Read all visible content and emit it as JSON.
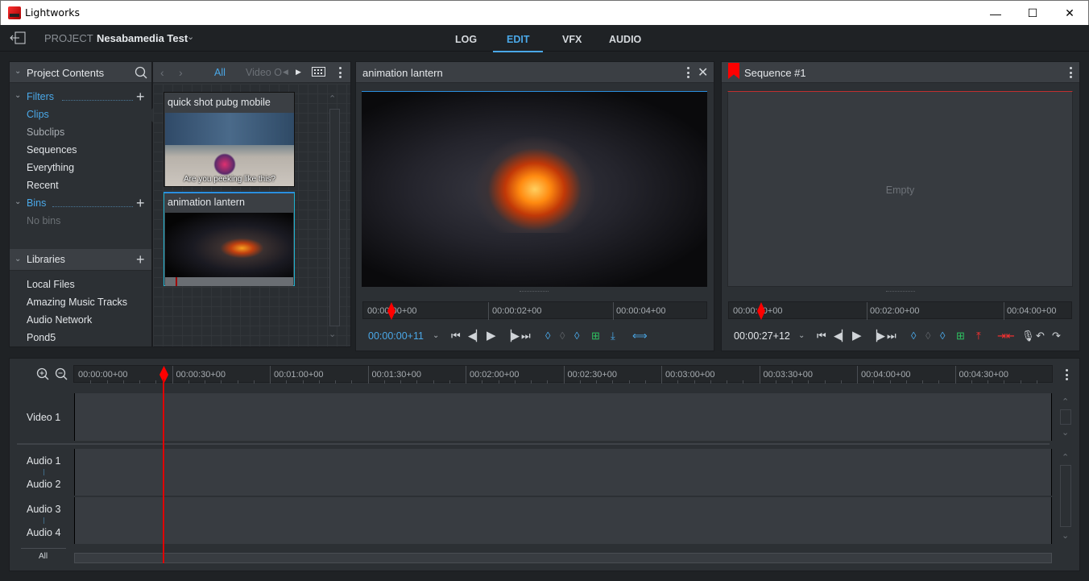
{
  "window": {
    "title": "Lightworks",
    "controls": {
      "minimize": "—",
      "maximize": "☐",
      "close": "✕"
    }
  },
  "topbar": {
    "project_label": "PROJECT",
    "project_name": "Nesabamedia Test",
    "project_chevron": "⌄",
    "tabs": [
      {
        "label": "LOG",
        "active": false
      },
      {
        "label": "EDIT",
        "active": true
      },
      {
        "label": "VFX",
        "active": false
      },
      {
        "label": "AUDIO",
        "active": false
      }
    ],
    "accent": "#4aa8e8"
  },
  "project_contents": {
    "title": "Project Contents",
    "filters": {
      "label": "Filters",
      "items": [
        {
          "label": "Clips",
          "state": "selected"
        },
        {
          "label": "Subclips",
          "state": "dim"
        },
        {
          "label": "Sequences",
          "state": "normal"
        },
        {
          "label": "Everything",
          "state": "normal"
        },
        {
          "label": "Recent",
          "state": "normal"
        }
      ]
    },
    "bins": {
      "label": "Bins",
      "empty_text": "No bins"
    },
    "libraries": {
      "label": "Libraries",
      "items": [
        "Local Files",
        "Amazing Music Tracks",
        "Audio Network",
        "Pond5"
      ]
    }
  },
  "bin_browser": {
    "filter_all": "All",
    "filter_video": "Video O",
    "clips": [
      {
        "title": "quick shot pubg mobile",
        "caption": "Are you peeking like this?",
        "selected": false
      },
      {
        "title": "animation lantern",
        "selected": true
      }
    ]
  },
  "source_viewer": {
    "title": "animation lantern",
    "ruler": [
      "00:00:00+00",
      "00:00:02+00",
      "00:00:04+00"
    ],
    "timecode": "00:00:00+11",
    "playhead_fraction": 0.07
  },
  "record_viewer": {
    "title": "Sequence #1",
    "empty_text": "Empty",
    "ruler": [
      "00:00:00+00",
      "00:02:00+00",
      "00:04:00+00"
    ],
    "timecode": "00:00:27+12",
    "playhead_fraction": 0.09
  },
  "timeline": {
    "ruler": [
      "00:00:00+00",
      "00:00:30+00",
      "00:01:00+00",
      "00:01:30+00",
      "00:02:00+00",
      "00:02:30+00",
      "00:03:00+00",
      "00:03:30+00",
      "00:04:00+00",
      "00:04:30+00"
    ],
    "tracks": {
      "video1": "Video 1",
      "audio1": "Audio 1",
      "audio2": "Audio 2",
      "audio3": "Audio 3",
      "audio4": "Audio 4",
      "all": "All"
    },
    "playhead_time": "00:00:27+12"
  }
}
